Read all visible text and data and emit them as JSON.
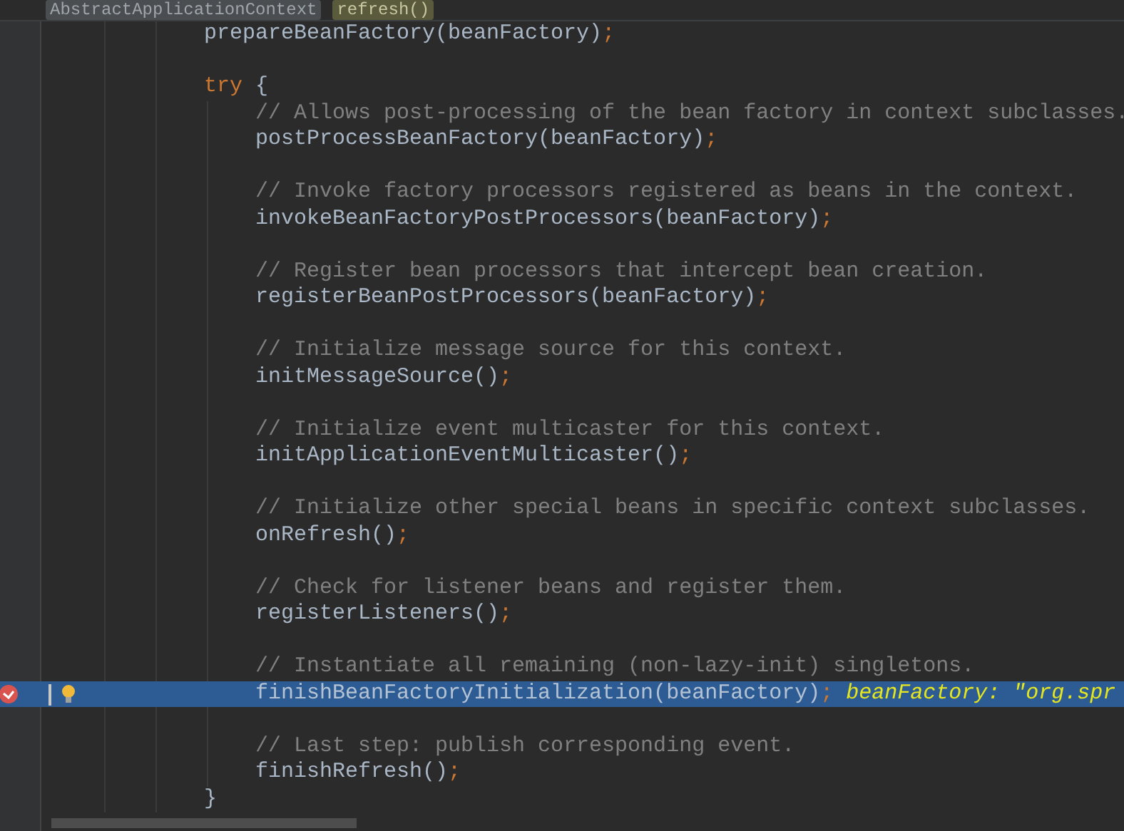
{
  "breadcrumbs": [
    {
      "label": "AbstractApplicationContext",
      "selected": false
    },
    {
      "label": "refresh()",
      "selected": true
    }
  ],
  "lines": [
    {
      "tokens": [
        {
          "kind": "plain",
          "text": "prepareBeanFactory(beanFactory)"
        },
        {
          "kind": "punct",
          "text": ";"
        }
      ],
      "space_after": true,
      "selected": false,
      "breakpoint": false
    },
    {
      "tokens": [
        {
          "kind": "keyword",
          "text": "try"
        },
        {
          "kind": "plain",
          "text": " {"
        }
      ],
      "space_after": false,
      "selected": false,
      "breakpoint": false,
      "children": [
        {
          "tokens": [
            {
              "kind": "comment",
              "text": "// Allows post-processing of the bean factory in context subclasses."
            }
          ],
          "space_after": false,
          "selected": false,
          "breakpoint": false
        },
        {
          "tokens": [
            {
              "kind": "plain",
              "text": "postProcessBeanFactory(beanFactory)"
            },
            {
              "kind": "punct",
              "text": ";"
            }
          ],
          "space_after": true,
          "selected": false,
          "breakpoint": false
        },
        {
          "tokens": [
            {
              "kind": "comment",
              "text": "// Invoke factory processors registered as beans in the context."
            }
          ],
          "space_after": false,
          "selected": false,
          "breakpoint": false
        },
        {
          "tokens": [
            {
              "kind": "plain",
              "text": "invokeBeanFactoryPostProcessors(beanFactory)"
            },
            {
              "kind": "punct",
              "text": ";"
            }
          ],
          "space_after": true,
          "selected": false,
          "breakpoint": false
        },
        {
          "tokens": [
            {
              "kind": "comment",
              "text": "// Register bean processors that intercept bean creation."
            }
          ],
          "space_after": false,
          "selected": false,
          "breakpoint": false
        },
        {
          "tokens": [
            {
              "kind": "plain",
              "text": "registerBeanPostProcessors(beanFactory)"
            },
            {
              "kind": "punct",
              "text": ";"
            }
          ],
          "space_after": true,
          "selected": false,
          "breakpoint": false
        },
        {
          "tokens": [
            {
              "kind": "comment",
              "text": "// Initialize message source for this context."
            }
          ],
          "space_after": false,
          "selected": false,
          "breakpoint": false
        },
        {
          "tokens": [
            {
              "kind": "plain",
              "text": "initMessageSource()"
            },
            {
              "kind": "punct",
              "text": ";"
            }
          ],
          "space_after": true,
          "selected": false,
          "breakpoint": false
        },
        {
          "tokens": [
            {
              "kind": "comment",
              "text": "// Initialize event multicaster for this context."
            }
          ],
          "space_after": false,
          "selected": false,
          "breakpoint": false
        },
        {
          "tokens": [
            {
              "kind": "plain",
              "text": "initApplicationEventMulticaster()"
            },
            {
              "kind": "punct",
              "text": ";"
            }
          ],
          "space_after": true,
          "selected": false,
          "breakpoint": false
        },
        {
          "tokens": [
            {
              "kind": "comment",
              "text": "// Initialize other special beans in specific context subclasses."
            }
          ],
          "space_after": false,
          "selected": false,
          "breakpoint": false
        },
        {
          "tokens": [
            {
              "kind": "plain",
              "text": "onRefresh()"
            },
            {
              "kind": "punct",
              "text": ";"
            }
          ],
          "space_after": true,
          "selected": false,
          "breakpoint": false
        },
        {
          "tokens": [
            {
              "kind": "comment",
              "text": "// Check for listener beans and register them."
            }
          ],
          "space_after": false,
          "selected": false,
          "breakpoint": false
        },
        {
          "tokens": [
            {
              "kind": "plain",
              "text": "registerListeners()"
            },
            {
              "kind": "punct",
              "text": ";"
            }
          ],
          "space_after": true,
          "selected": false,
          "breakpoint": false
        },
        {
          "tokens": [
            {
              "kind": "comment",
              "text": "// Instantiate all remaining (non-lazy-init) singletons."
            }
          ],
          "space_after": false,
          "selected": false,
          "breakpoint": false
        },
        {
          "tokens": [
            {
              "kind": "plain",
              "text": "finishBeanFactoryInitialization(beanFactory)"
            },
            {
              "kind": "punct",
              "text": ";"
            },
            {
              "kind": "inline-value",
              "text": "beanFactory: \"org.spr"
            }
          ],
          "space_after": true,
          "selected": true,
          "breakpoint": true
        },
        {
          "tokens": [
            {
              "kind": "comment",
              "text": "// Last step: publish corresponding event."
            }
          ],
          "space_after": false,
          "selected": false,
          "breakpoint": false
        },
        {
          "tokens": [
            {
              "kind": "plain",
              "text": "finishRefresh()"
            },
            {
              "kind": "punct",
              "text": ";"
            }
          ],
          "space_after": false,
          "selected": false,
          "breakpoint": false
        }
      ]
    },
    {
      "tokens": [
        {
          "kind": "plain",
          "text": "}"
        }
      ],
      "space_after": false,
      "selected": false,
      "breakpoint": false
    }
  ]
}
